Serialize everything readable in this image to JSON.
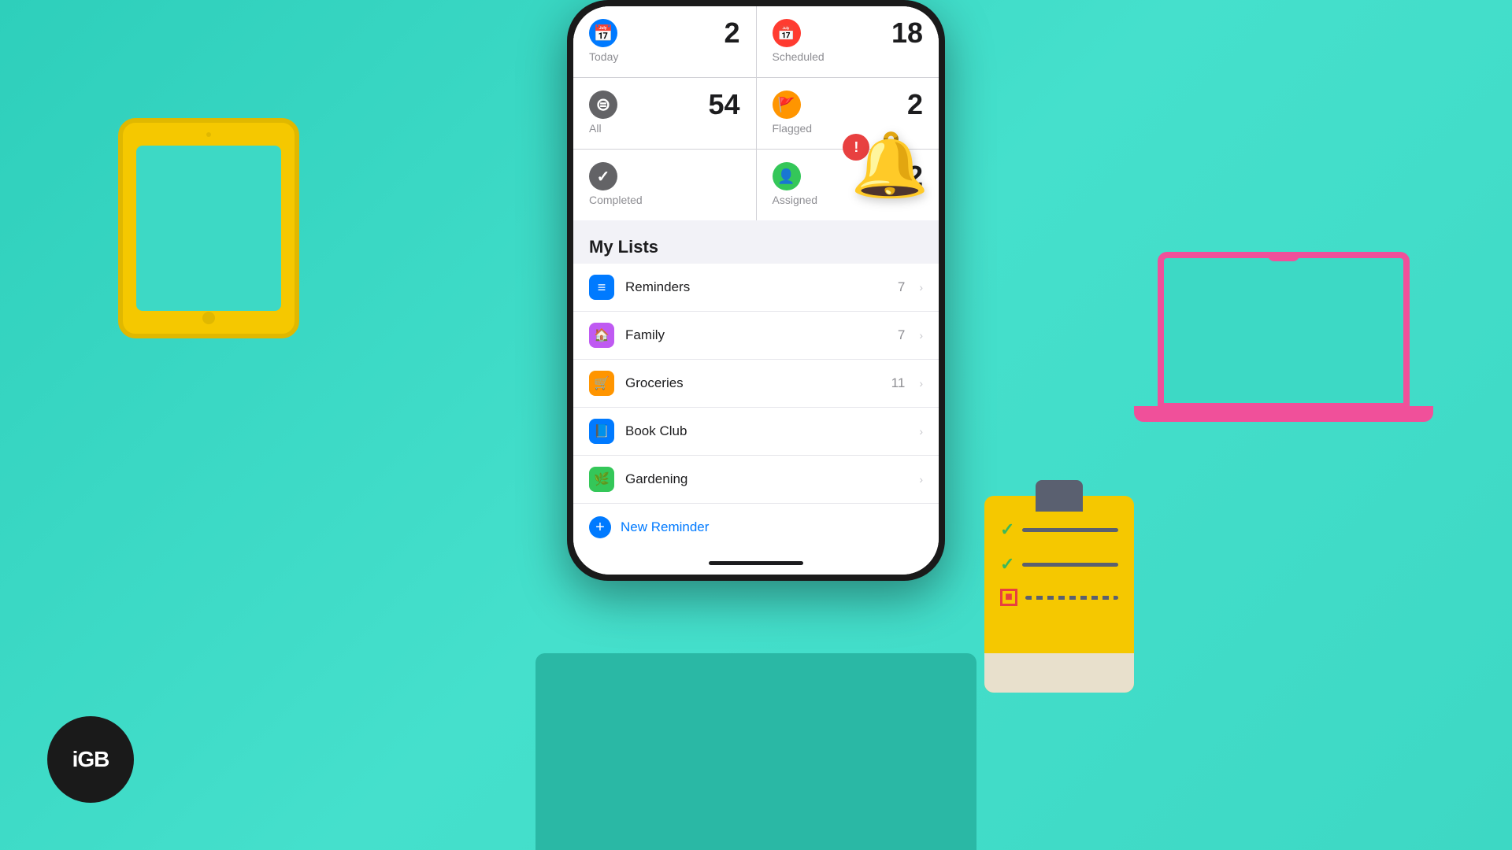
{
  "background": {
    "color": "#3dd9c5"
  },
  "logo": {
    "text": "iGB"
  },
  "phone": {
    "smart_cards": [
      {
        "id": "today",
        "label": "Today",
        "count": "2",
        "icon_color": "#007aff",
        "icon": "📅"
      },
      {
        "id": "scheduled",
        "label": "Scheduled",
        "count": "18",
        "icon_color": "#ff3b30",
        "icon": "📆"
      },
      {
        "id": "all",
        "label": "All",
        "count": "54",
        "icon_color": "#636366",
        "icon": "⊜"
      },
      {
        "id": "flagged",
        "label": "Flagged",
        "count": "2",
        "icon_color": "#ff9500",
        "icon": "🚩"
      },
      {
        "id": "completed",
        "label": "Completed",
        "count": "",
        "icon_color": "#636366",
        "icon": "✓"
      },
      {
        "id": "assigned",
        "label": "Assigned",
        "count": "2",
        "icon_color": "#34c759",
        "icon": "👤"
      }
    ],
    "my_lists_header": "My Lists",
    "lists": [
      {
        "id": "reminders",
        "name": "Reminders",
        "count": "7",
        "icon_color": "#007aff",
        "icon": "≡"
      },
      {
        "id": "family",
        "name": "Family",
        "count": "7",
        "icon_color": "#bf5af2",
        "icon": "🏠"
      },
      {
        "id": "groceries",
        "name": "Groceries",
        "count": "11",
        "icon_color": "#ff9500",
        "icon": "🛒"
      },
      {
        "id": "book-club",
        "name": "Book Club",
        "count": "",
        "icon_color": "#007aff",
        "icon": "📘"
      },
      {
        "id": "gardening",
        "name": "Gardening",
        "count": "",
        "icon_color": "#34c759",
        "icon": "🌿"
      }
    ],
    "new_reminder_label": "New Reminder"
  },
  "notification": {
    "bell_color": "#f5c800",
    "badge_color": "#e84040",
    "badge_icon": "!"
  },
  "clipboard": {
    "rows": [
      {
        "check": "✓",
        "style": "green",
        "line": "dark"
      },
      {
        "check": "✓",
        "style": "green",
        "line": "dark"
      },
      {
        "check": "□",
        "style": "red",
        "line": "dashed"
      }
    ]
  }
}
